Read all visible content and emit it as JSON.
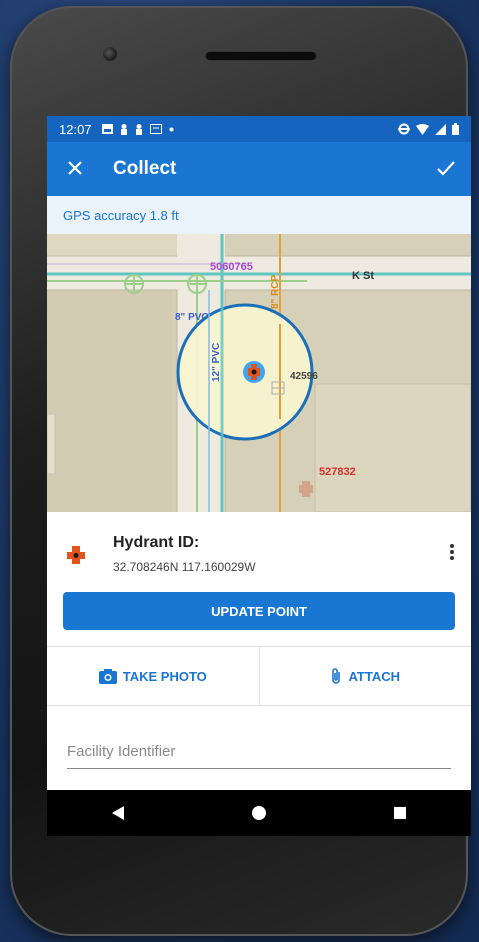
{
  "status_bar": {
    "time": "12:07"
  },
  "app_bar": {
    "title": "Collect"
  },
  "gps": {
    "text": "GPS accuracy 1.8 ft"
  },
  "map": {
    "labels": {
      "id_top": "5060765",
      "street": "K St",
      "pipe_h": "8\" PVC",
      "pipe_v": "12\" PVC",
      "pipe_rcp": "8\" RCP",
      "id_partial": "42596",
      "id_red": "527832"
    },
    "colors": {
      "id_top": "#a94ad1",
      "id_red": "#d32f2f",
      "pipe": "#3a5fcd",
      "rcp": "#d88a1a",
      "accent": "#1976d2"
    }
  },
  "feature": {
    "title": "Hydrant ID:",
    "coords": "32.708246N 117.160029W"
  },
  "buttons": {
    "update_point": "UPDATE POINT",
    "take_photo": "TAKE PHOTO",
    "attach": "ATTACH"
  },
  "form": {
    "facility_placeholder": "Facility Identifier"
  }
}
